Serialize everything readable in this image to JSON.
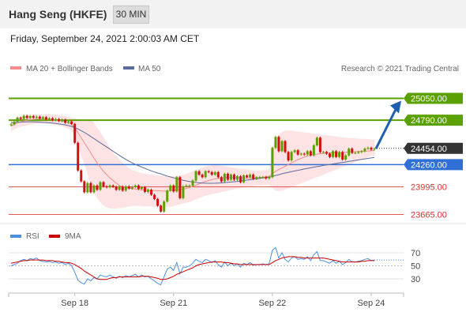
{
  "header": {
    "title": "Hang Seng (HKFE)",
    "timeframe": "30 MIN"
  },
  "date_line": "Friday, September 24, 2021 2:00:03 AM CET",
  "credit": "Research © 2021 Trading Central",
  "colors": {
    "header_bg": "#f2f2f2",
    "bollinger": "#fcd9d9",
    "ma20": "#f48c8c",
    "ma50": "#5b6c9c",
    "resistance": "#5aa000",
    "pivot": "#2f6fd6",
    "support": "#e03030",
    "last_price": "#333333",
    "candle_up": "#5aa000",
    "candle_down": "#d01010",
    "rsi": "#4a90e2",
    "rsi_ma": "#cc0000",
    "arrow": "#1f5fb0"
  },
  "chart_data": [
    {
      "type": "candlestick",
      "title": "Hang Seng (HKFE)",
      "legend": [
        "MA 20 + Bollinger Bands",
        "MA 50"
      ],
      "x_tick_labels": [
        "Sep 18",
        "Sep 21",
        "Sep 22",
        "Sep 24"
      ],
      "x_ticks_at_bar": [
        20,
        51,
        82,
        113
      ],
      "levels": [
        {
          "role": "resistance",
          "label": "25050.00",
          "value": 25050
        },
        {
          "role": "resistance",
          "label": "24790.00",
          "value": 24790
        },
        {
          "role": "last",
          "label": "24454.00",
          "value": 24454
        },
        {
          "role": "pivot",
          "label": "24260.00",
          "value": 24260
        },
        {
          "role": "support",
          "label": "23995.00",
          "value": 23995
        },
        {
          "role": "support",
          "label": "23665.00",
          "value": 23665
        }
      ],
      "ylim": [
        23600,
        25120
      ],
      "close": [
        24740,
        24772,
        24820,
        24805,
        24842,
        24816,
        24838,
        24820,
        24831,
        24810,
        24825,
        24800,
        24812,
        24790,
        24802,
        24780,
        24795,
        24760,
        24775,
        24745,
        24520,
        24190,
        24060,
        23930,
        24040,
        23930,
        24010,
        23960,
        24050,
        24000,
        23990,
        24010,
        23995,
        23960,
        23998,
        23950,
        24000,
        23975,
        23990,
        24010,
        23970,
        23990,
        23935,
        23960,
        23900,
        23850,
        23770,
        23700,
        23820,
        23950,
        24010,
        23940,
        24110,
        23860,
        24000,
        24010,
        24010,
        24070,
        24180,
        24140,
        24110,
        24180,
        24170,
        24140,
        24170,
        24110,
        24060,
        24150,
        24080,
        24140,
        24080,
        24120,
        24050,
        24130,
        24110,
        24140,
        24090,
        24110,
        24110,
        24110,
        24095,
        24110,
        24460,
        24590,
        24420,
        24540,
        24410,
        24310,
        24410,
        24430,
        24380,
        24390,
        24380,
        24420,
        24370,
        24490,
        24580,
        24410,
        24410,
        24390,
        24350,
        24420,
        24350,
        24410,
        24320,
        24370,
        24450,
        24400,
        24400,
        24410,
        24420,
        24450,
        24460,
        24440,
        24450
      ],
      "ma20": [
        24720,
        24740,
        24760,
        24770,
        24780,
        24790,
        24795,
        24800,
        24805,
        24808,
        24810,
        24805,
        24800,
        24795,
        24790,
        24785,
        24780,
        24770,
        24760,
        24740,
        24700,
        24640,
        24580,
        24520,
        24460,
        24400,
        24340,
        24280,
        24230,
        24180,
        24140,
        24100,
        24070,
        24040,
        24010,
        23995,
        23985,
        23978,
        23972,
        23968,
        23964,
        23960,
        23957,
        23955,
        23952,
        23950,
        23948,
        23945,
        23944,
        23945,
        23950,
        23955,
        23960,
        23965,
        23970,
        23975,
        23985,
        24000,
        24015,
        24030,
        24045,
        24060,
        24070,
        24080,
        24090,
        24095,
        24100,
        24105,
        24110,
        24110,
        24108,
        24105,
        24103,
        24100,
        24100,
        24100,
        24100,
        24100,
        24105,
        24110,
        24115,
        24120,
        24150,
        24180,
        24200,
        24220,
        24240,
        24260,
        24280,
        24300,
        24320,
        24335,
        24350,
        24362,
        24372,
        24380,
        24385,
        24390,
        24393,
        24396,
        24398,
        24400,
        24402,
        24404,
        24405,
        24407,
        24410,
        24412,
        24414,
        24416,
        24418,
        24420,
        24422,
        24425,
        24428
      ],
      "bb_upper": [
        24780,
        24800,
        24815,
        24825,
        24835,
        24845,
        24850,
        24855,
        24858,
        24860,
        24860,
        24860,
        24858,
        24856,
        24855,
        24850,
        24845,
        24840,
        24830,
        24820,
        24810,
        24800,
        24790,
        24785,
        24780,
        24790,
        24760,
        24700,
        24650,
        24590,
        24520,
        24460,
        24400,
        24360,
        24320,
        24280,
        24250,
        24220,
        24195,
        24180,
        24170,
        24160,
        24150,
        24145,
        24140,
        24135,
        24130,
        24128,
        24125,
        24124,
        24123,
        24124,
        24125,
        24130,
        24140,
        24150,
        24165,
        24180,
        24195,
        24210,
        24225,
        24238,
        24245,
        24250,
        24255,
        24250,
        24245,
        24240,
        24232,
        24228,
        24222,
        24216,
        24210,
        24205,
        24200,
        24195,
        24193,
        24190,
        24190,
        24192,
        24195,
        24205,
        24460,
        24560,
        24620,
        24650,
        24665,
        24665,
        24665,
        24660,
        24655,
        24650,
        24645,
        24640,
        24635,
        24630,
        24625,
        24620,
        24615,
        24610,
        24605,
        24600,
        24595,
        24590,
        24585,
        24580,
        24578,
        24575,
        24572,
        24570,
        24568,
        24566,
        24565,
        24560,
        24558
      ],
      "bb_lower": [
        24660,
        24680,
        24700,
        24710,
        24720,
        24730,
        24735,
        24740,
        24745,
        24748,
        24750,
        24750,
        24745,
        24740,
        24735,
        24725,
        24715,
        24700,
        24690,
        24660,
        24590,
        24480,
        24370,
        24260,
        24140,
        24010,
        23920,
        23860,
        23810,
        23770,
        23750,
        23740,
        23730,
        23735,
        23740,
        23745,
        23750,
        23760,
        23765,
        23768,
        23768,
        23766,
        23764,
        23762,
        23760,
        23755,
        23752,
        23750,
        23749,
        23750,
        23756,
        23765,
        23775,
        23785,
        23795,
        23805,
        23815,
        23830,
        23845,
        23860,
        23875,
        23888,
        23898,
        23906,
        23914,
        23922,
        23930,
        23940,
        23950,
        23958,
        23966,
        23974,
        23980,
        23988,
        23992,
        23998,
        24002,
        24007,
        24010,
        24013,
        24018,
        24022,
        23980,
        23950,
        23945,
        23950,
        23960,
        23975,
        23990,
        24005,
        24020,
        24035,
        24050,
        24065,
        24080,
        24095,
        24110,
        24125,
        24140,
        24155,
        24170,
        24185,
        24200,
        24215,
        24230,
        24245,
        24260,
        24275,
        24290,
        24305,
        24320,
        24335,
        24350,
        24360,
        24370
      ],
      "ma50": [
        24760,
        24762,
        24764,
        24766,
        24768,
        24770,
        24770,
        24769,
        24768,
        24766,
        24764,
        24762,
        24759,
        24755,
        24750,
        24745,
        24740,
        24733,
        24725,
        24715,
        24700,
        24685,
        24665,
        24645,
        24620,
        24595,
        24570,
        24545,
        24520,
        24495,
        24470,
        24445,
        24420,
        24395,
        24370,
        24345,
        24322,
        24300,
        24280,
        24262,
        24245,
        24230,
        24215,
        24200,
        24185,
        24172,
        24160,
        24148,
        24136,
        24124,
        24113,
        24102,
        24092,
        24082,
        24073,
        24065,
        24058,
        24052,
        24047,
        24043,
        24040,
        24038,
        24037,
        24037,
        24038,
        24040,
        24042,
        24045,
        24048,
        24052,
        24056,
        24060,
        24065,
        24070,
        24075,
        24080,
        24085,
        24090,
        24095,
        24100,
        24105,
        24110,
        24120,
        24130,
        24140,
        24150,
        24160,
        24168,
        24176,
        24184,
        24192,
        24200,
        24208,
        24215,
        24222,
        24229,
        24236,
        24243,
        24250,
        24256,
        24262,
        24268,
        24274,
        24280,
        24286,
        24292,
        24298,
        24304,
        24310,
        24316,
        24322,
        24328,
        24334,
        24340,
        24346
      ]
    },
    {
      "type": "line",
      "legend": [
        "RSI",
        "9MA"
      ],
      "y_tick_labels": [
        "70",
        "50",
        "30"
      ],
      "ylim": [
        10,
        90
      ],
      "rsi": [
        50,
        52,
        54,
        58,
        60,
        58,
        61,
        60,
        62,
        58,
        57,
        56,
        57,
        55,
        56,
        54,
        55,
        52,
        54,
        50,
        40,
        28,
        24,
        22,
        30,
        27,
        32,
        30,
        36,
        34,
        33,
        36,
        33,
        31,
        34,
        32,
        35,
        33,
        35,
        37,
        33,
        36,
        33,
        34,
        30,
        27,
        23,
        21,
        33,
        45,
        48,
        43,
        55,
        38,
        48,
        48,
        50,
        54,
        60,
        57,
        55,
        60,
        58,
        55,
        58,
        52,
        48,
        56,
        50,
        54,
        50,
        53,
        48,
        54,
        52,
        55,
        51,
        52,
        52,
        53,
        52,
        53,
        74,
        78,
        62,
        70,
        60,
        56,
        62,
        64,
        60,
        61,
        60,
        64,
        58,
        67,
        72,
        58,
        58,
        56,
        54,
        58,
        54,
        57,
        52,
        55,
        60,
        56,
        56,
        57,
        58,
        60,
        61,
        58,
        59
      ],
      "ma9": [
        54,
        55,
        56,
        57,
        58,
        58,
        59,
        59,
        59,
        59,
        59,
        58,
        58,
        58,
        57,
        57,
        56,
        55,
        55,
        54,
        52,
        49,
        46,
        42,
        39,
        36,
        33,
        30,
        29,
        29,
        29,
        31,
        32,
        32,
        33,
        33,
        33,
        33,
        33,
        33,
        33,
        34,
        34,
        34,
        33,
        32,
        31,
        29,
        29,
        30,
        32,
        34,
        37,
        39,
        41,
        43,
        45,
        47,
        50,
        52,
        53,
        54,
        55,
        56,
        56,
        56,
        56,
        55,
        55,
        54,
        53,
        53,
        52,
        52,
        52,
        52,
        52,
        52,
        52,
        52,
        52,
        52,
        55,
        58,
        60,
        62,
        63,
        64,
        64,
        64,
        63,
        63,
        62,
        62,
        62,
        62,
        62,
        62,
        62,
        61,
        60,
        59,
        58,
        57,
        56,
        56,
        56,
        56,
        56,
        56,
        57,
        57,
        58,
        58,
        58
      ]
    }
  ]
}
